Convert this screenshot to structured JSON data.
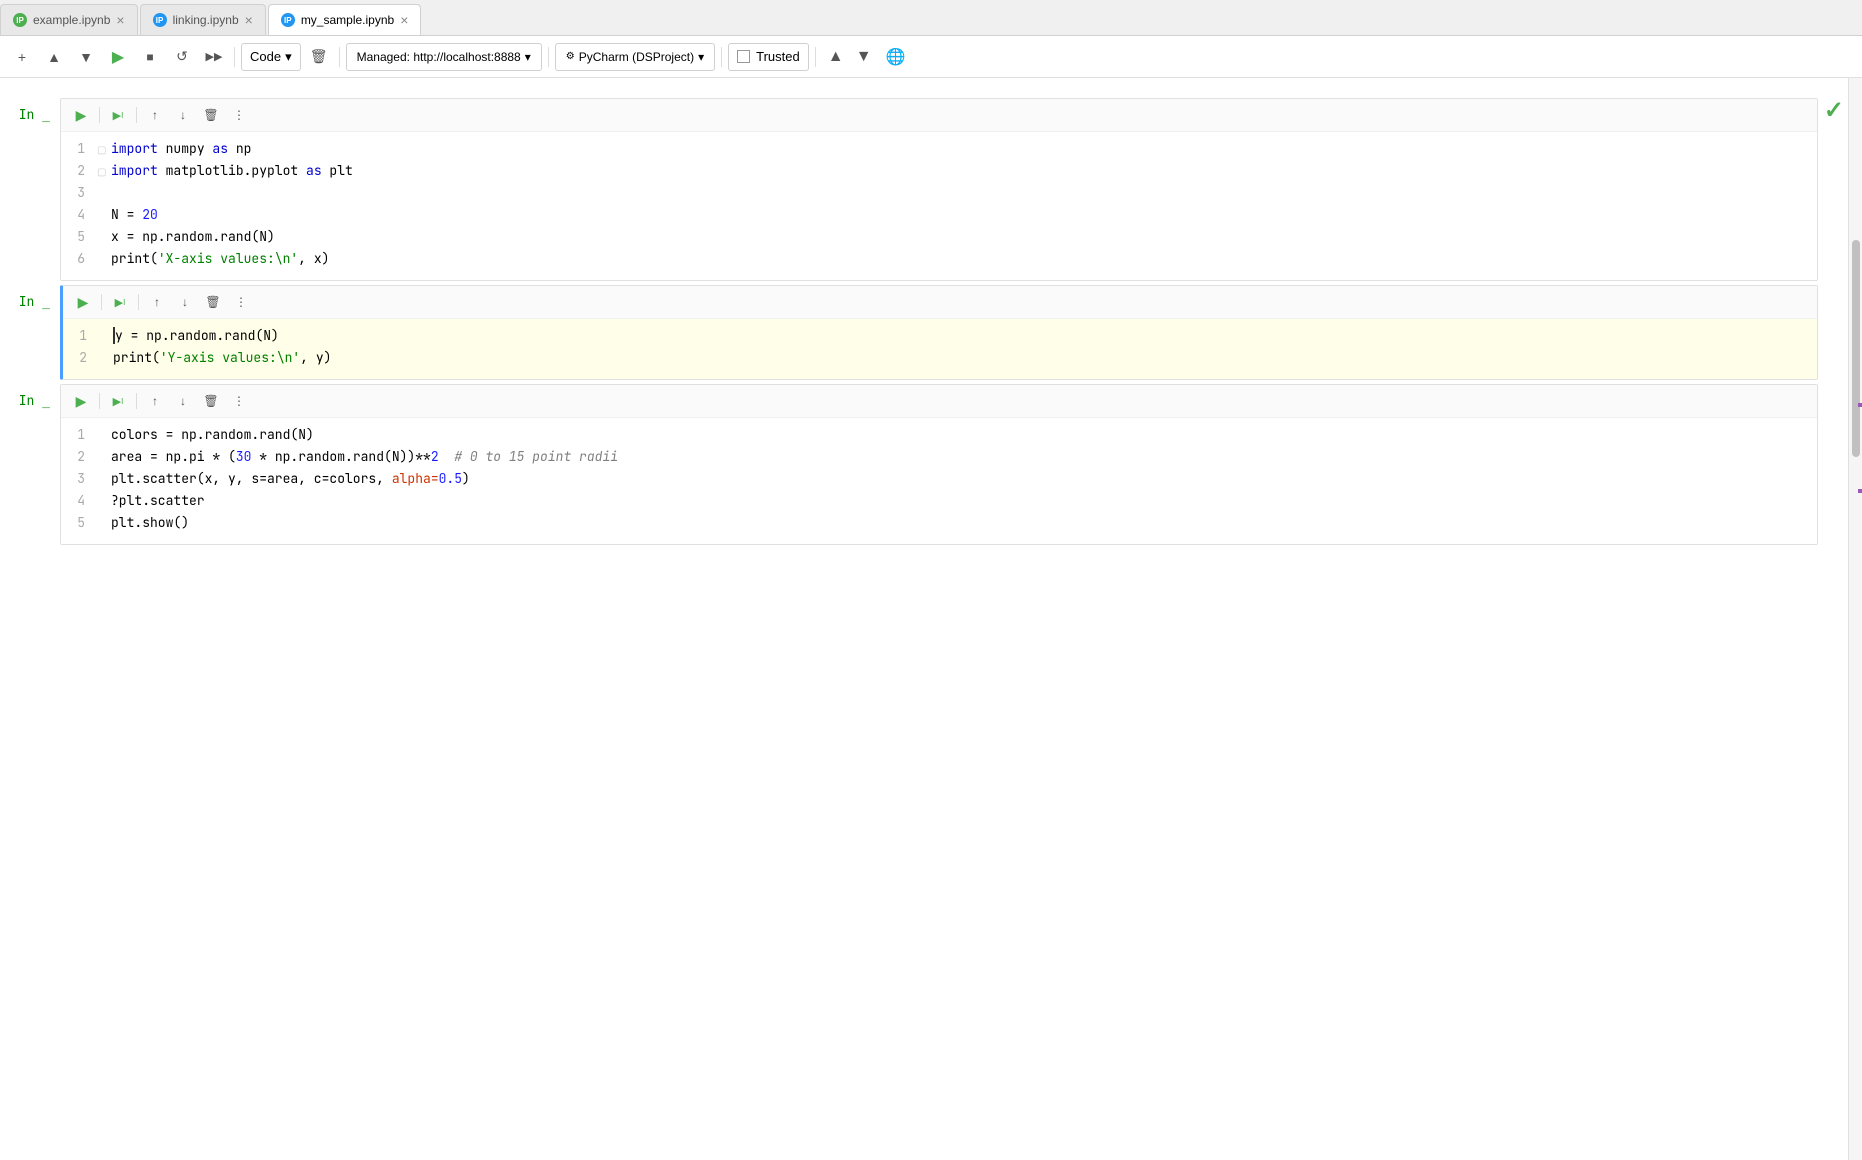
{
  "tabs": [
    {
      "id": "tab1",
      "label": "example.ipynb",
      "active": false,
      "icon_color": "green"
    },
    {
      "id": "tab2",
      "label": "linking.ipynb",
      "active": false,
      "icon_color": "blue"
    },
    {
      "id": "tab3",
      "label": "my_sample.ipynb",
      "active": true,
      "icon_color": "blue"
    }
  ],
  "toolbar": {
    "add_label": "+",
    "run_above_label": "▲",
    "run_below_label": "▼",
    "run_label": "▶",
    "code_label": "Code",
    "trash_label": "🗑",
    "stop_label": "■",
    "restart_label": "↺",
    "run_all_label": "▶▶",
    "kernel_label": "Managed: http://localhost:8888",
    "pycharm_label": "PyCharm (DSProject)",
    "trusted_label": "Trusted",
    "up_label": "▲",
    "down_label": "▼",
    "internet_label": "🌐"
  },
  "cells": [
    {
      "id": "cell1",
      "label": "In _",
      "active": false,
      "lines": [
        {
          "num": 1,
          "tokens": [
            {
              "t": "kw",
              "v": "import"
            },
            {
              "t": "plain",
              "v": " numpy "
            },
            {
              "t": "kw",
              "v": "as"
            },
            {
              "t": "plain",
              "v": " np"
            }
          ]
        },
        {
          "num": 2,
          "tokens": [
            {
              "t": "kw",
              "v": "import"
            },
            {
              "t": "plain",
              "v": " matplotlib.pyplot "
            },
            {
              "t": "kw",
              "v": "as"
            },
            {
              "t": "plain",
              "v": " plt"
            }
          ]
        },
        {
          "num": 3,
          "tokens": []
        },
        {
          "num": 4,
          "tokens": [
            {
              "t": "plain",
              "v": "N = "
            },
            {
              "t": "num",
              "v": "20"
            }
          ]
        },
        {
          "num": 5,
          "tokens": [
            {
              "t": "plain",
              "v": "x = np.random.rand(N)"
            }
          ]
        },
        {
          "num": 6,
          "tokens": [
            {
              "t": "plain",
              "v": "print("
            },
            {
              "t": "str",
              "v": "'X-axis values:\\n'"
            },
            {
              "t": "plain",
              "v": ", x)"
            }
          ]
        }
      ]
    },
    {
      "id": "cell2",
      "label": "In _",
      "active": true,
      "lines": [
        {
          "num": 1,
          "tokens": [
            {
              "t": "plain",
              "v": "y = np.random.rand(N)"
            }
          ]
        },
        {
          "num": 2,
          "tokens": [
            {
              "t": "plain",
              "v": "print("
            },
            {
              "t": "str",
              "v": "'Y-axis values:\\n'"
            },
            {
              "t": "plain",
              "v": ", y)"
            }
          ]
        }
      ]
    },
    {
      "id": "cell3",
      "label": "In _",
      "active": false,
      "lines": [
        {
          "num": 1,
          "tokens": [
            {
              "t": "plain",
              "v": "colors = np.random.rand(N)"
            }
          ]
        },
        {
          "num": 2,
          "tokens": [
            {
              "t": "plain",
              "v": "area = np.pi * ("
            },
            {
              "t": "num",
              "v": "30"
            },
            {
              "t": "plain",
              "v": " * np.random.rand(N))**"
            },
            {
              "t": "num",
              "v": "2"
            },
            {
              "t": "comment",
              "v": "  # 0 to 15 point radii"
            }
          ]
        },
        {
          "num": 3,
          "tokens": [
            {
              "t": "plain",
              "v": "plt.scatter(x, y, s=area, c=colors, "
            },
            {
              "t": "param",
              "v": "alpha="
            },
            {
              "t": "num",
              "v": "0.5"
            },
            {
              "t": "plain",
              "v": ")"
            }
          ]
        },
        {
          "num": 4,
          "tokens": [
            {
              "t": "plain",
              "v": "?plt.scatter"
            }
          ]
        },
        {
          "num": 5,
          "tokens": [
            {
              "t": "plain",
              "v": "plt.show()"
            }
          ]
        }
      ]
    }
  ],
  "scrollbar": {
    "thumb_top": "15%",
    "thumb_height": "20%",
    "mark1_top": "30%",
    "mark2_top": "38%"
  }
}
